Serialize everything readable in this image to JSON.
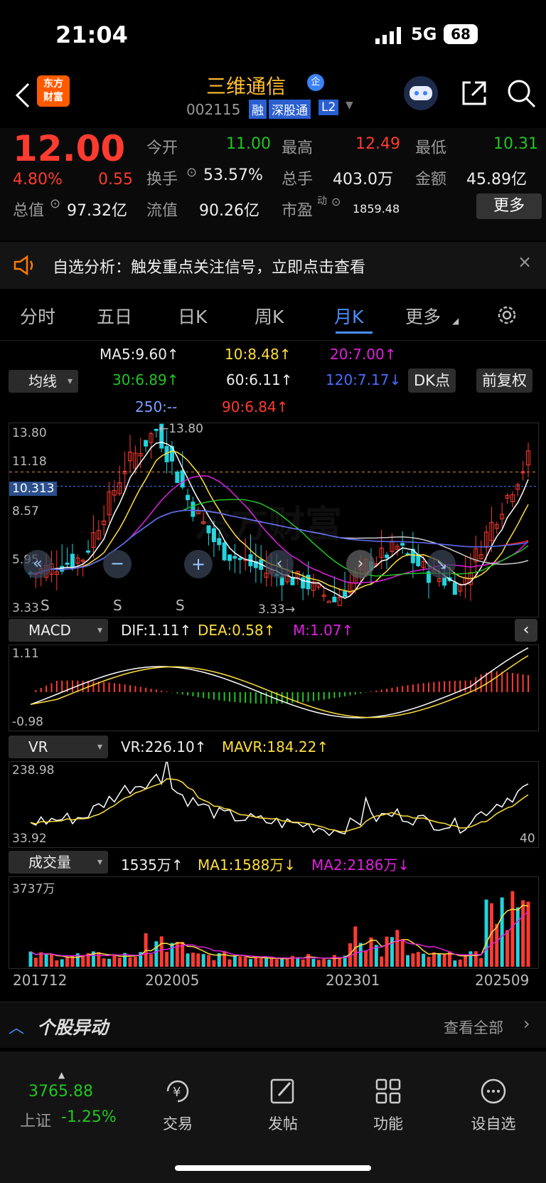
{
  "status_bar": {
    "time": "21:04",
    "network": "5G",
    "battery": "68"
  },
  "header": {
    "app_badge": "东方\n财富",
    "stock_name": "三维通信",
    "badge": "企",
    "stock_code": "002115",
    "tags": [
      "融",
      "深股通",
      "L2"
    ]
  },
  "quote": {
    "price": "12.00",
    "change_pct": "4.80%",
    "change": "0.55",
    "open_label": "今开",
    "open": "11.00",
    "high_label": "最高",
    "high": "12.49",
    "low_label": "最低",
    "low": "10.31",
    "turnover_label": "换手",
    "turnover": "53.57%",
    "volume_label": "总手",
    "volume": "403.0万",
    "amount_label": "金额",
    "amount": "45.89亿",
    "mktcap_label": "总值",
    "mktcap": "97.32亿",
    "float_label": "流值",
    "float_cap": "90.26亿",
    "pe_label": "市盈",
    "pe_sup": "动",
    "pe": "1859.48",
    "more_button": "更多"
  },
  "notice": {
    "text": "自选分析：触发重点关注信号，立即点击查看"
  },
  "tabs": [
    "分时",
    "五日",
    "日K",
    "周K",
    "月K",
    "更多"
  ],
  "active_tab": "月K",
  "ma_legend": {
    "selector": "均线",
    "ma5": "MA5:9.60↑",
    "ma10": "10:8.48↑",
    "ma20": "20:7.00↑",
    "ma30": "30:6.89↑",
    "ma60": "60:6.11↑",
    "ma120": "120:7.17↓",
    "ma250": "250:--",
    "ma90": "90:6.84↑",
    "dk_button": "DK点",
    "adjust_button": "前复权"
  },
  "main_chart": {
    "y_labels": [
      "13.80",
      "11.18",
      "8.57",
      "5.95",
      "3.33"
    ],
    "current_label": "10.313",
    "high_marker": "←13.80",
    "low_marker": "3.33→",
    "watermark": "东方财富",
    "signal_labels": [
      "S",
      "S",
      "S"
    ]
  },
  "macd": {
    "selector": "MACD",
    "dif": "DIF:1.11↑",
    "dea": "DEA:0.58↑",
    "m": "M:1.07↑",
    "y_top": "1.11",
    "y_bottom": "-0.98"
  },
  "vr": {
    "selector": "VR",
    "vr": "VR:226.10↑",
    "mavr": "MAVR:184.22↑",
    "y_top": "238.98",
    "y_bottom": "33.92",
    "right_label": "40"
  },
  "volume": {
    "selector": "成交量",
    "vol": "1535万↑",
    "ma1": "MA1:1588万↓",
    "ma2": "MA2:2186万↓",
    "y_top": "3737万"
  },
  "x_labels": [
    "201712",
    "202005",
    "202301",
    "202509"
  ],
  "movement": {
    "title": "个股异动",
    "view_all": "查看全部"
  },
  "bottom_nav": {
    "index_value": "3765.88",
    "index_name": "上证",
    "index_change": "-1.25%",
    "items": [
      "交易",
      "发帖",
      "功能",
      "设自选"
    ]
  },
  "colors": {
    "up": "#ff3b30",
    "down": "#21c521",
    "cyan": "#22d3dd",
    "yellow": "#ffdf3a",
    "magenta": "#e020e0",
    "accent_blue": "#3b82f6",
    "brand": "#ff7a00"
  },
  "chart_data": {
    "type": "candlestick",
    "period": "monthly",
    "x_labels": [
      "201712",
      "202005",
      "202301",
      "202509"
    ],
    "price_range": [
      3.33,
      13.8
    ],
    "high": 13.8,
    "low": 3.33,
    "last_close": 12.0,
    "ma": {
      "MA5": 9.6,
      "MA10": 8.48,
      "MA20": 7.0,
      "MA30": 6.89,
      "MA60": 6.11,
      "MA120": 7.17,
      "MA90": 6.84
    },
    "macd": {
      "DIF": 1.11,
      "DEA": 0.58,
      "M": 1.07,
      "range": [
        -0.98,
        1.11
      ]
    },
    "vr": {
      "VR": 226.1,
      "MAVR": 184.22,
      "range": [
        33.92,
        238.98
      ]
    },
    "volume": {
      "latest": "1535万",
      "MA1": "1588万",
      "MA2": "2186万",
      "max": "3737万"
    }
  }
}
